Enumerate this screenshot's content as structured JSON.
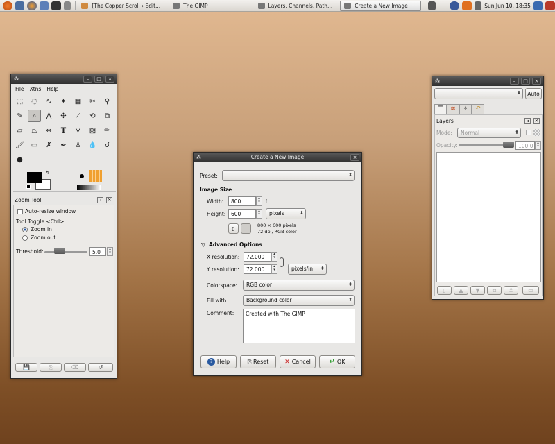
{
  "panel": {
    "tasks": [
      "[The Copper Scroll › Edit...",
      "The GIMP",
      "Layers, Channels, Path...",
      "Create a New Image"
    ],
    "clock": "Sun Jun 10, 18:35"
  },
  "toolbox": {
    "menu": [
      "File",
      "Xtns",
      "Help"
    ],
    "tool_options_title": "Zoom Tool",
    "auto_resize": "Auto-resize window",
    "toggle_label": "Tool Toggle  <Ctrl>",
    "zoom_in": "Zoom in",
    "zoom_out": "Zoom out",
    "threshold_label": "Threshold:",
    "threshold_value": "5.0"
  },
  "dialog": {
    "title": "Create a New Image",
    "preset_label": "Preset:",
    "preset_value": "",
    "image_size_heading": "Image Size",
    "width_label": "Width:",
    "width_value": "800",
    "height_label": "Height:",
    "height_value": "600",
    "unit": "pixels",
    "info_line1": "800 × 600 pixels",
    "info_line2": "72 dpi, RGB color",
    "advanced_heading": "Advanced Options",
    "xres_label": "X resolution:",
    "xres_value": "72.000",
    "yres_label": "Y resolution:",
    "yres_value": "72.000",
    "res_unit": "pixels/in",
    "colorspace_label": "Colorspace:",
    "colorspace_value": "RGB color",
    "fill_label": "Fill with:",
    "fill_value": "Background color",
    "comment_label": "Comment:",
    "comment_value": "Created with The GIMP",
    "help_button": "Help",
    "reset_button": "Reset",
    "cancel_button": "Cancel",
    "ok_button": "OK"
  },
  "layers": {
    "auto_button": "Auto",
    "title": "Layers",
    "mode_label": "Mode:",
    "mode_value": "Normal",
    "opacity_label": "Opacity:",
    "opacity_value": "100.0",
    "opacity_level": 1.0
  },
  "colors": {
    "fg": "#000000",
    "bg": "#ffffff",
    "brush_accent": "#f0a030"
  }
}
